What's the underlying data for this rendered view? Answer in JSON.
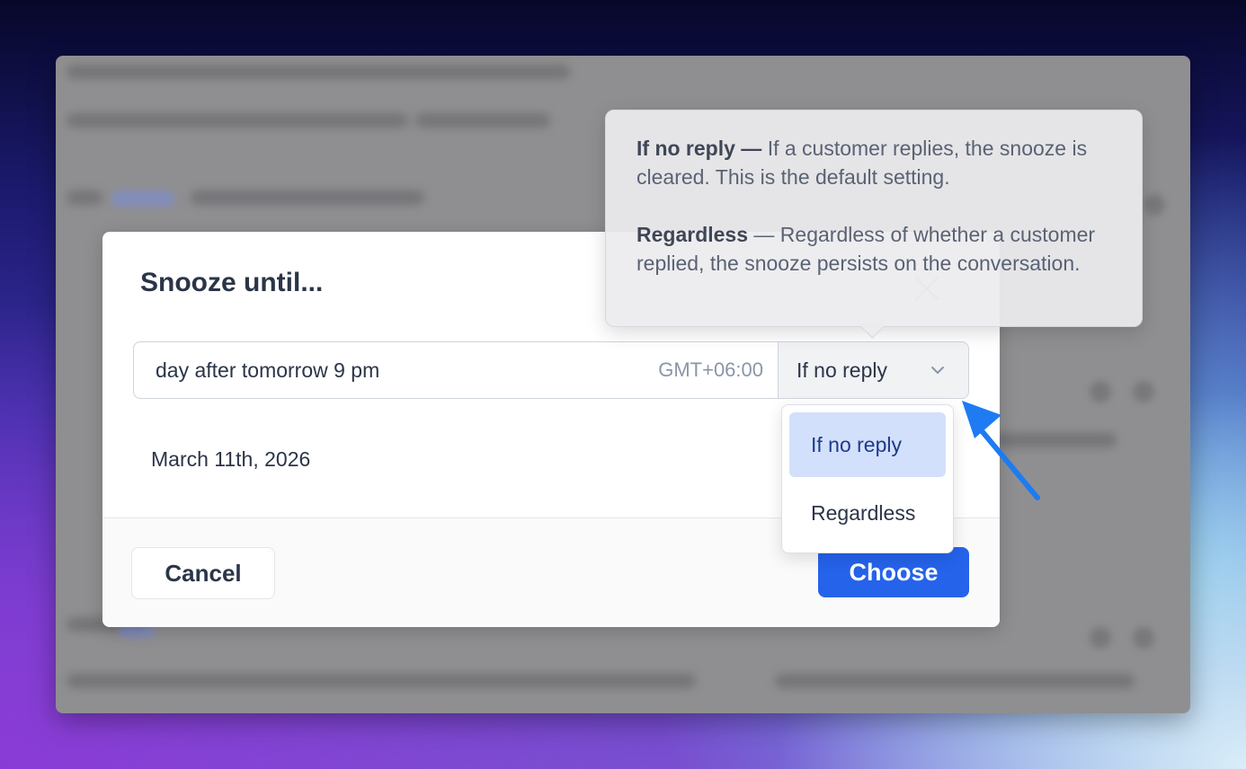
{
  "modal": {
    "title": "Snooze until...",
    "time_input_value": "day after tomorrow 9 pm",
    "timezone": "GMT+06:00",
    "mode_select_value": "If no reply",
    "resolved_date": "March 11th, 2026",
    "cancel_label": "Cancel",
    "choose_label": "Choose",
    "accent_color": "#2563eb"
  },
  "dropdown": {
    "options": [
      {
        "label": "If no reply",
        "selected": true
      },
      {
        "label": "Regardless",
        "selected": false
      }
    ]
  },
  "tooltip": {
    "items": [
      {
        "term": "If no reply",
        "separator": " — ",
        "description": "If a customer replies, the snoo​ze is cleared. This is the default setting."
      },
      {
        "term": "Regardless",
        "separator": " — ",
        "description": "Regardless of whether a custo​mer replied, the snooze persists on the conve​rsation."
      }
    ]
  },
  "annotation": {
    "arrow_color": "#1e7bf2",
    "icon": "arrow-pointer-icon"
  }
}
